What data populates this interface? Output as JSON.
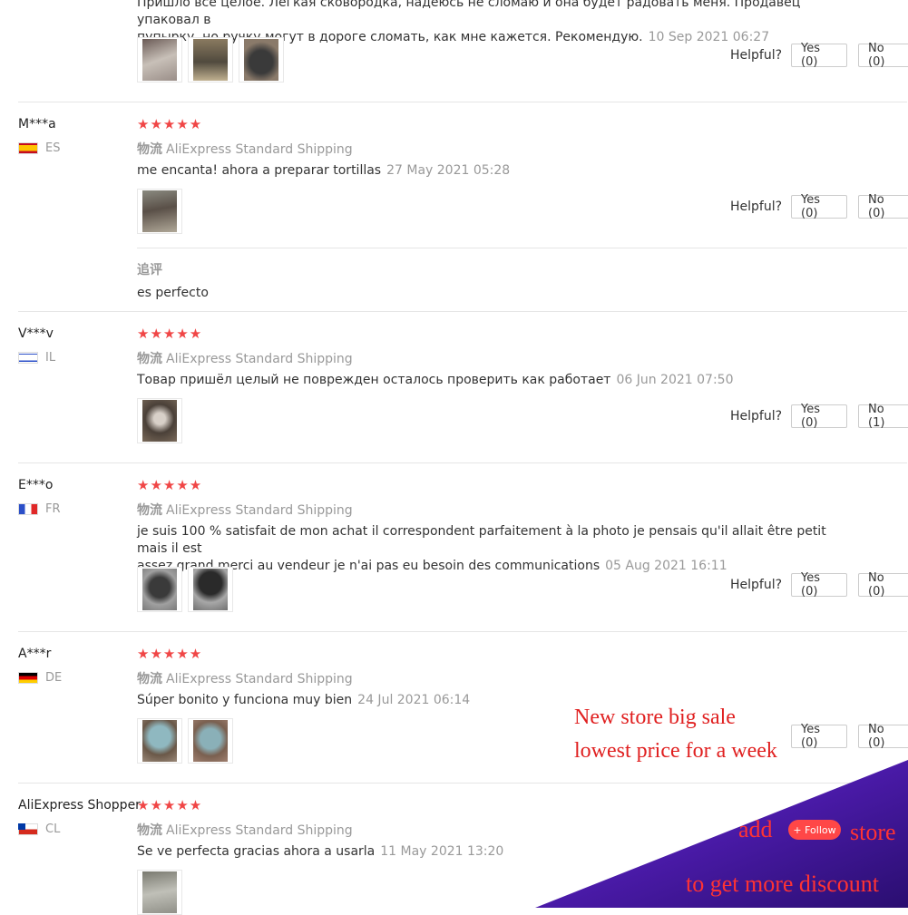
{
  "helpful_label": "Helpful?",
  "reviews_top": {
    "text_line1": "Пришло все целое. Легкая сковородка, надеюсь не сломаю и она будет радовать меня. Продавец упаковал в",
    "text_line2": "пупырку, но ручку могут в дороге сломать, как мне кажется. Рекомендую.",
    "date": "10 Sep 2021 06:27",
    "yes": "Yes (0)",
    "no": "No (0)"
  },
  "reviews": [
    {
      "user": "M***a",
      "country": "ES",
      "stars": "★★★★★",
      "ship_label": "物流",
      "shipping": "AliExpress Standard Shipping",
      "text": "me encanta! ahora a preparar tortillas",
      "date": "27 May 2021 05:28",
      "yes": "Yes (0)",
      "no": "No (0)",
      "followup_label": "追评",
      "followup_text": "es perfecto"
    },
    {
      "user": "V***v",
      "country": "IL",
      "stars": "★★★★★",
      "ship_label": "物流",
      "shipping": "AliExpress Standard Shipping",
      "text": "Товар пришёл целый не поврежден осталось проверить как работает",
      "date": "06 Jun 2021 07:50",
      "yes": "Yes (0)",
      "no": "No (1)"
    },
    {
      "user": "E***o",
      "country": "FR",
      "stars": "★★★★★",
      "ship_label": "物流",
      "shipping": "AliExpress Standard Shipping",
      "text_line1": "je suis 100 % satisfait de mon achat il correspondent parfaitement à la photo je pensais qu'il allait être petit mais il est",
      "text_line2": "assez grand merci au vendeur je n'ai pas eu besoin des communications",
      "date": "05 Aug 2021 16:11",
      "yes": "Yes (0)",
      "no": "No (0)"
    },
    {
      "user": "A***r",
      "country": "DE",
      "stars": "★★★★★",
      "ship_label": "物流",
      "shipping": "AliExpress Standard Shipping",
      "text": "Súper bonito y funciona muy bien",
      "date": "24 Jul 2021 06:14",
      "yes": "Yes (0)",
      "no": "No (0)"
    },
    {
      "user": "AliExpress Shopper",
      "country": "CL",
      "stars": "★★★★★",
      "ship_label": "物流",
      "shipping": "AliExpress Standard Shipping",
      "text": "Se ve perfecta gracias ahora a usarla",
      "date": "11 May 2021 13:20"
    }
  ],
  "promo": {
    "line1": "New store big sale",
    "line2": "lowest price for a week",
    "add": "add",
    "follow": "+ Follow",
    "store": "store",
    "discount": "to get more discount"
  },
  "colors": {
    "star": "#f04646",
    "promo_red": "#e02020",
    "banner_purple": "#4a1aa8"
  }
}
